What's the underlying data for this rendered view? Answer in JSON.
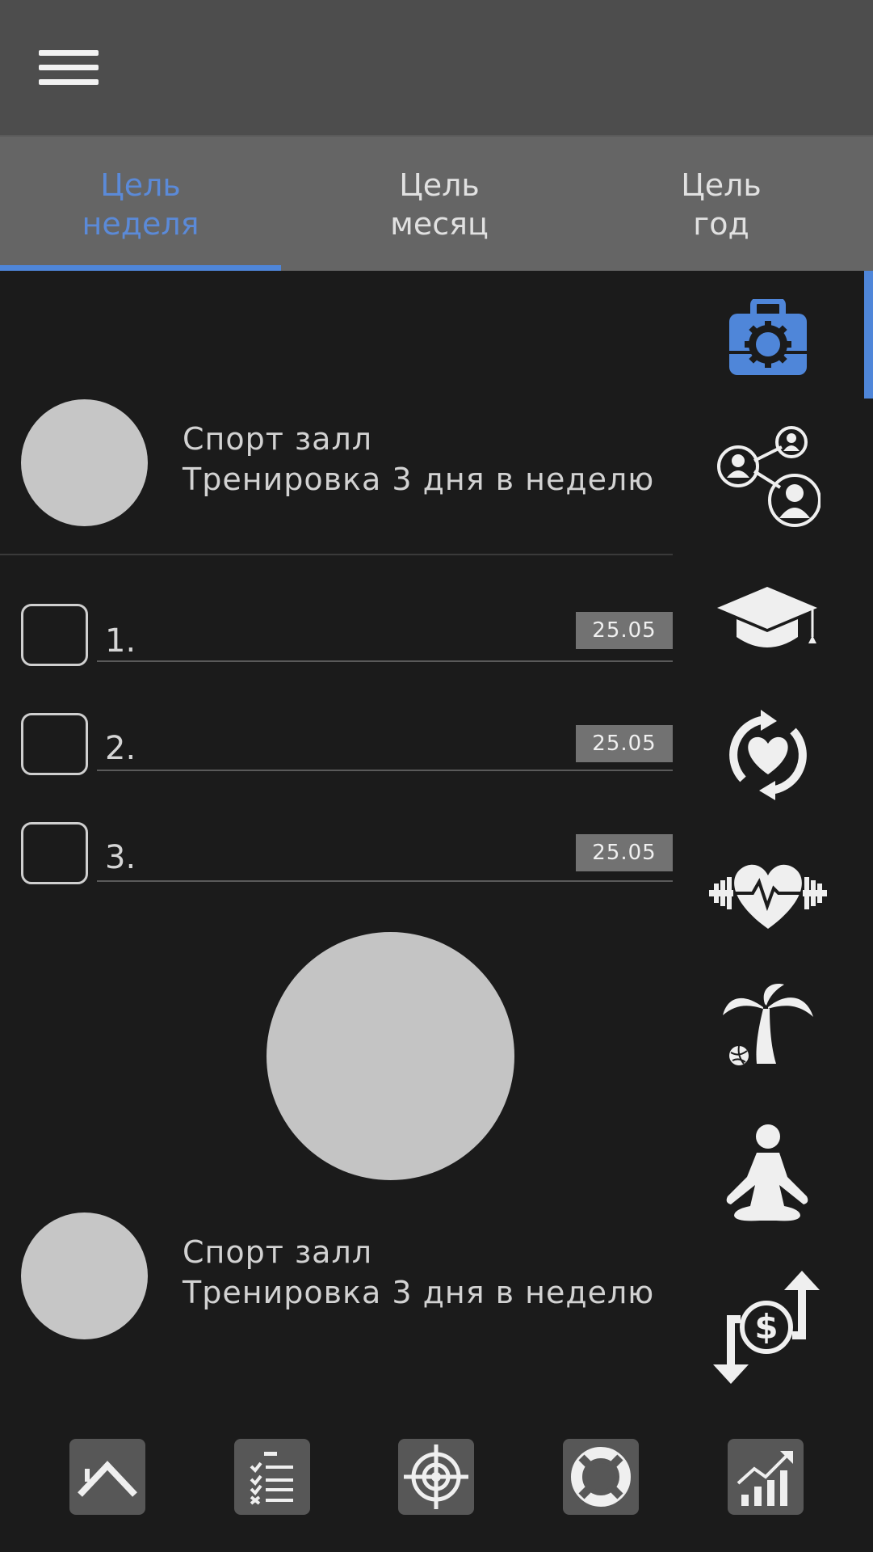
{
  "tabs": [
    {
      "label": "Цель\nнеделя",
      "active": true
    },
    {
      "label": "Цель\nмесяц",
      "active": false
    },
    {
      "label": "Цель\nгод",
      "active": false
    }
  ],
  "goals": [
    {
      "title": "Спорт залл",
      "subtitle": "Тренировка 3 дня в неделю"
    },
    {
      "title": "Спорт залл",
      "subtitle": "Тренировка 3 дня в неделю"
    }
  ],
  "tasks": [
    {
      "num": "1.",
      "date": "25.05"
    },
    {
      "num": "2.",
      "date": "25.05"
    },
    {
      "num": "3.",
      "date": "25.05"
    }
  ],
  "sidebar_icons": [
    "briefcase-gear-icon",
    "network-people-icon",
    "graduation-cap-icon",
    "heart-cycle-icon",
    "fitness-heart-icon",
    "palm-tree-icon",
    "meditation-icon",
    "money-exchange-icon"
  ],
  "bottom_nav": [
    "home-icon",
    "checklist-icon",
    "target-icon",
    "lifebuoy-icon",
    "growth-chart-icon"
  ],
  "colors": {
    "accent": "#4f86d9",
    "background": "#1b1b1b",
    "topbar": "#4d4d4d",
    "tabs": "#656565",
    "icon": "#efefef"
  }
}
